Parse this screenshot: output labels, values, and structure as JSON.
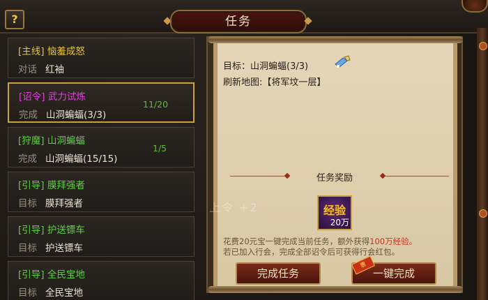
{
  "header": {
    "title": "任务",
    "help_label": "?"
  },
  "quests": [
    {
      "tag": "[主线]",
      "name": "恼羞成怒",
      "kind": "对话",
      "target": "红袖",
      "progress": "",
      "tag_color": "yellow"
    },
    {
      "tag": "[诏令]",
      "name": "武力试炼",
      "kind": "完成",
      "target": "山洞蝙蝠(3/3)",
      "progress": "11/20",
      "tag_color": "purple"
    },
    {
      "tag": "[狩魔]",
      "name": "山洞蝙蝠",
      "kind": "完成",
      "target": "山洞蝙蝠(15/15)",
      "progress": "1/5",
      "tag_color": "green"
    },
    {
      "tag": "[引导]",
      "name": "膜拜强者",
      "kind": "目标",
      "target": "膜拜强者",
      "progress": "",
      "tag_color": "green"
    },
    {
      "tag": "[引导]",
      "name": "护送镖车",
      "kind": "目标",
      "target": "护送镖车",
      "progress": "",
      "tag_color": "green"
    },
    {
      "tag": "[引导]",
      "name": "全民宝地",
      "kind": "目标",
      "target": "全民宝地",
      "progress": "",
      "tag_color": "green"
    }
  ],
  "selected_quest_index": 1,
  "detail": {
    "target_line": "目标：山洞蝙蝠(3/3)",
    "map_line": "刷新地图:【将军坟一层】",
    "reward_heading": "任务奖励",
    "reward_item": {
      "word": "经验",
      "amount": "20万"
    },
    "ghost_text": "上令  +2",
    "desc_line1_a": "花费20元宝一键完成当前任务，额外获得",
    "desc_line1_b": "100万经验",
    "desc_line1_c": "。",
    "desc_line2": "若已加入行会，完成全部诏令后可获得行会红包。",
    "complete_button": "完成任务",
    "oneclick_button": "一键完成",
    "badge": "惠"
  },
  "colors": {
    "yellow": "#e8c43c",
    "purple": "#e040e0",
    "green": "#5cd040",
    "accent_gold": "#c9a23a"
  }
}
